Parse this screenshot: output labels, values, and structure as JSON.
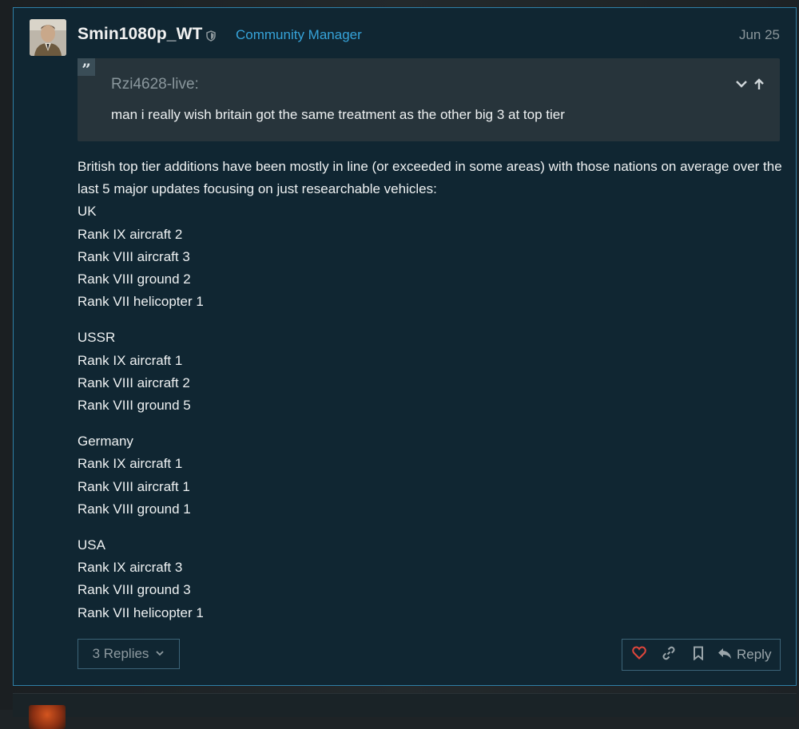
{
  "post": {
    "username": "Smin1080p_WT",
    "user_title": "Community Manager",
    "date": "Jun 25",
    "avatar_icon": "avatar-portrait",
    "moderator_icon": "shield-icon",
    "quote": {
      "author": "Rzi4628-live:",
      "text": "man i really wish britain got the same treatment as the other big 3 at top tier"
    },
    "body": {
      "intro": "British top tier additions have been mostly in line (or exceeded in some areas) with those nations on average over the last 5 major updates focusing on just researchable vehicles:",
      "groups": [
        {
          "nation": "UK",
          "items": [
            "Rank IX aircraft 2",
            "Rank VIII aircraft 3",
            "Rank VIII ground 2",
            "Rank VII helicopter 1"
          ]
        },
        {
          "nation": "USSR",
          "items": [
            "Rank IX aircraft 1",
            "Rank VIII aircraft 2",
            "Rank VIII ground 5"
          ]
        },
        {
          "nation": "Germany",
          "items": [
            "Rank IX aircraft 1",
            "Rank VIII aircraft 1",
            "Rank VIII ground 1"
          ]
        },
        {
          "nation": "USA",
          "items": [
            "Rank IX aircraft 3",
            "Rank VIII ground 3",
            "Rank VII helicopter 1"
          ]
        }
      ]
    },
    "replies_label": "3 Replies",
    "reply_label": "Reply"
  },
  "colors": {
    "post_bg": "#102632",
    "post_border": "#2f7fa6",
    "accent": "#36a3d9",
    "like": "#e0463c"
  }
}
